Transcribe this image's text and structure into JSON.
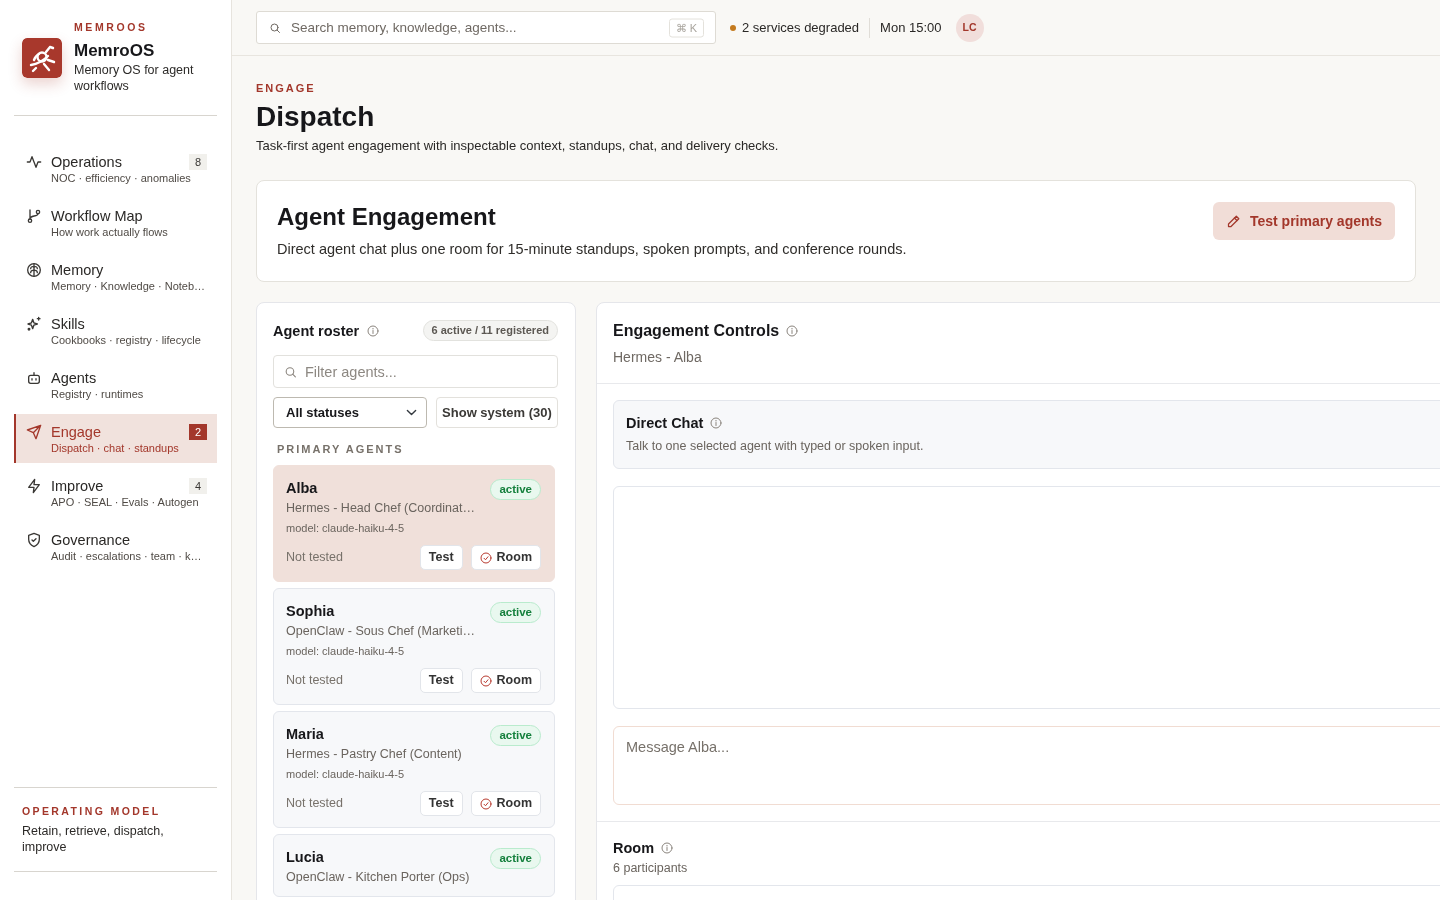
{
  "sidebar": {
    "brand_label": "MEMROOS",
    "app_name": "MemroOS",
    "tagline": "Memory OS for agent workflows",
    "nav_items": [
      {
        "title": "Operations",
        "subtitle": "NOC · efficiency · anomalies",
        "badge": "8",
        "selected": false
      },
      {
        "title": "Workflow Map",
        "subtitle": "How work actually flows",
        "selected": false
      },
      {
        "title": "Memory",
        "subtitle": "Memory · Knowledge · Noteb…",
        "selected": false
      },
      {
        "title": "Skills",
        "subtitle": "Cookbooks · registry · lifecycle",
        "selected": false
      },
      {
        "title": "Agents",
        "subtitle": "Registry · runtimes",
        "selected": false
      },
      {
        "title": "Engage",
        "subtitle": "Dispatch · chat · standups",
        "badge": "2",
        "selected": true
      },
      {
        "title": "Improve",
        "subtitle": "APO · SEAL · Evals · Autogen",
        "badge": "4",
        "selected": false
      },
      {
        "title": "Governance",
        "subtitle": "Audit · escalations · team · k…",
        "selected": false
      }
    ],
    "footer": {
      "heading": "OPERATING MODEL",
      "text": "Retain, retrieve, dispatch, improve"
    }
  },
  "topbar": {
    "search": {
      "placeholder": "Search memory, knowledge, agents...",
      "shortcut": "⌘ K"
    },
    "status": "2 services degraded",
    "time": "Mon 15:00",
    "avatar": "LC"
  },
  "header": {
    "eyebrow": "ENGAGE",
    "title": "Dispatch",
    "description": "Task-first agent engagement with inspectable context, standups, chat, and delivery checks."
  },
  "engagement": {
    "title": "Agent Engagement",
    "description": "Direct agent chat plus one room for 15-minute standups, spoken prompts, and conference rounds.",
    "button": "Test primary agents"
  },
  "roster": {
    "title": "Agent roster",
    "count": "6 active / 11 registered",
    "filter": {
      "placeholder": "Filter agents..."
    },
    "status_filter": "All statuses",
    "system_button": "Show system (30)",
    "section": "PRIMARY AGENTS",
    "agents": [
      {
        "name": "Alba",
        "status": "active",
        "role": "Hermes - Head Chef (Coordinat…",
        "model": "model: claude-haiku-4-5",
        "test_result": "Not tested",
        "test_button": "Test",
        "room_button": "Room",
        "selected": true
      },
      {
        "name": "Sophia",
        "status": "active",
        "role": "OpenClaw - Sous Chef (Marketi…",
        "model": "model: claude-haiku-4-5",
        "test_result": "Not tested",
        "test_button": "Test",
        "room_button": "Room",
        "selected": false
      },
      {
        "name": "Maria",
        "status": "active",
        "role": "Hermes - Pastry Chef (Content)",
        "model": "model: claude-haiku-4-5",
        "test_result": "Not tested",
        "test_button": "Test",
        "room_button": "Room",
        "selected": false
      },
      {
        "name": "Lucia",
        "status": "active",
        "role": "OpenClaw - Kitchen Porter (Ops)",
        "selected": false
      }
    ]
  },
  "controls": {
    "title": "Engagement Controls",
    "subtitle": "Hermes - Alba",
    "direct_chat": {
      "title": "Direct Chat",
      "description": "Talk to one selected agent with typed or spoken input.",
      "message": {
        "placeholder": "Message Alba..."
      }
    },
    "room": {
      "title": "Room",
      "participants": "6 participants"
    }
  }
}
